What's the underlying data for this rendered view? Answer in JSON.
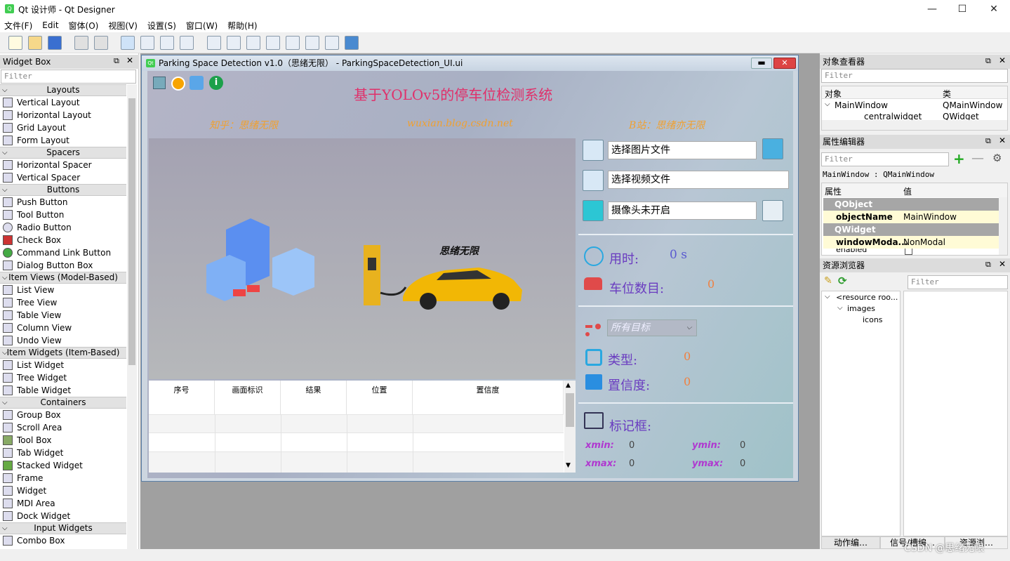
{
  "app": {
    "title": "Qt 设计师 - Qt Designer"
  },
  "window_controls": {
    "minimize": "—",
    "maximize": "☐",
    "close": "✕"
  },
  "menu": [
    "文件(F)",
    "Edit",
    "窗体(O)",
    "视图(V)",
    "设置(S)",
    "窗口(W)",
    "帮助(H)"
  ],
  "widget_box": {
    "title": "Widget Box",
    "filter_placeholder": "Filter",
    "categories": {
      "layouts": "Layouts",
      "spacers": "Spacers",
      "buttons": "Buttons",
      "item_views": "Item Views (Model-Based)",
      "item_widgets": "Item Widgets (Item-Based)",
      "containers": "Containers",
      "input_widgets": "Input Widgets"
    },
    "items": {
      "vertical_layout": "Vertical Layout",
      "horizontal_layout": "Horizontal Layout",
      "grid_layout": "Grid Layout",
      "form_layout": "Form Layout",
      "horizontal_spacer": "Horizontal Spacer",
      "vertical_spacer": "Vertical Spacer",
      "push_button": "Push Button",
      "tool_button": "Tool Button",
      "radio_button": "Radio Button",
      "check_box": "Check Box",
      "command_link_button": "Command Link Button",
      "dialog_button_box": "Dialog Button Box",
      "list_view": "List View",
      "tree_view": "Tree View",
      "table_view": "Table View",
      "column_view": "Column View",
      "undo_view": "Undo View",
      "list_widget": "List Widget",
      "tree_widget": "Tree Widget",
      "table_widget": "Table Widget",
      "group_box": "Group Box",
      "scroll_area": "Scroll Area",
      "tool_box": "Tool Box",
      "tab_widget": "Tab Widget",
      "stacked_widget": "Stacked Widget",
      "frame": "Frame",
      "widget": "Widget",
      "mdi_area": "MDI Area",
      "dock_widget": "Dock Widget",
      "combo_box": "Combo Box"
    }
  },
  "form": {
    "window_title": "Parking Space Detection v1.0（思绪无限） - ParkingSpaceDetection_UI.ui",
    "main_title": "基于YOLOv5的停车位检测系统",
    "credits": {
      "zhihu": "知乎：思绪无限",
      "blog": "wuxian.blog.csdn.net",
      "bili": "B站：思绪亦无限"
    },
    "image_logo": "思绪无限",
    "image_input": "选择图片文件",
    "video_input": "选择视频文件",
    "camera_input": "摄像头未开启",
    "time_label": "用时:",
    "time_value": "0 s",
    "count_label": "车位数目:",
    "count_value": "0",
    "target_select": "所有目标",
    "type_label": "类型:",
    "type_value": "0",
    "conf_label": "置信度:",
    "conf_value": "0",
    "box_label": "标记框:",
    "xmin_label": "xmin:",
    "xmin_value": "0",
    "ymin_label": "ymin:",
    "ymin_value": "0",
    "xmax_label": "xmax:",
    "xmax_value": "0",
    "ymax_label": "ymax:",
    "ymax_value": "0",
    "table_headers": [
      "序号",
      "画面标识",
      "结果",
      "位置",
      "置信度"
    ]
  },
  "object_inspector": {
    "title": "对象查看器",
    "filter_placeholder": "Filter",
    "col_object": "对象",
    "col_class": "类",
    "rows": [
      {
        "name": "MainWindow",
        "cls": "QMainWindow"
      },
      {
        "name": "centralwidget",
        "cls": "QWidget"
      }
    ]
  },
  "property_editor": {
    "title": "属性编辑器",
    "filter_placeholder": "Filter",
    "context": "MainWindow : QMainWindow",
    "col_property": "属性",
    "col_value": "值",
    "group_qobject": "QObject",
    "object_name_label": "objectName",
    "object_name_value": "MainWindow",
    "group_qwidget": "QWidget",
    "window_modality_label": "windowModa...",
    "window_modality_value": "NonModal",
    "enabled_label": "enabled"
  },
  "resource_browser": {
    "title": "资源浏览器",
    "filter_placeholder": "Filter",
    "tree": [
      "<resource roo...",
      "images",
      "icons"
    ]
  },
  "bottom_tabs": [
    "动作编…",
    "信号/槽编…",
    "资源浏…"
  ],
  "watermark": "CSDN @思绪无限"
}
